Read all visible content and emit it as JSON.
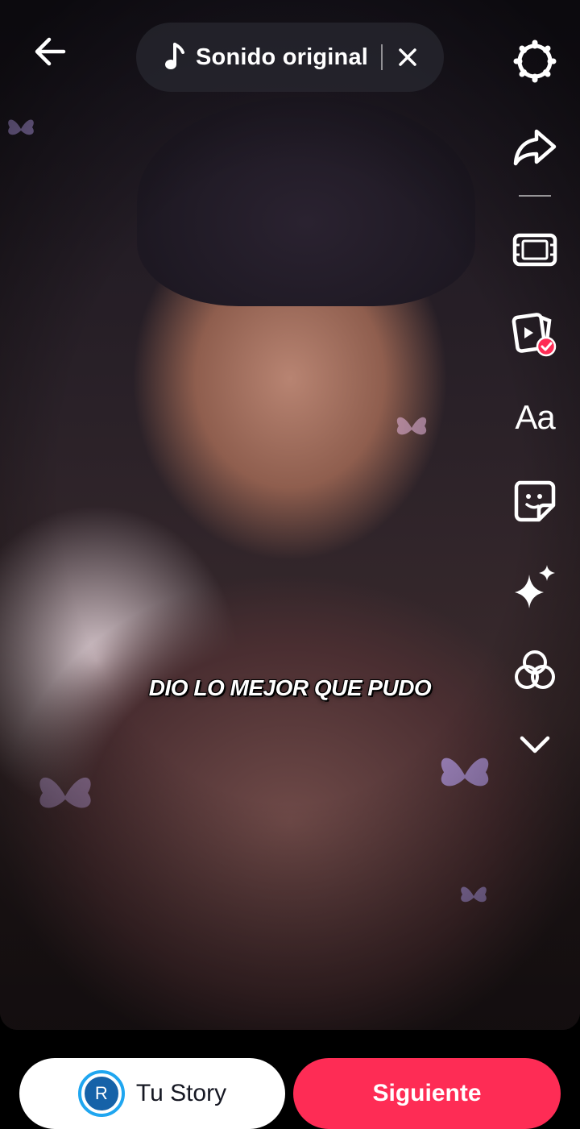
{
  "header": {
    "back_icon": "arrow-left-icon",
    "sound_label": "Sonido original",
    "sound_icon": "music-note-icon",
    "close_icon": "close-icon"
  },
  "tools": {
    "settings_icon": "gear-icon",
    "share_icon": "share-icon",
    "adjust_clips_icon": "film-frame-icon",
    "templates_icon": "video-check-icon",
    "text_label": "Aa",
    "sticker_icon": "sticker-icon",
    "effects_icon": "sparkle-icon",
    "filters_icon": "filters-icon",
    "more_icon": "chevron-down-icon"
  },
  "overlay": {
    "caption": "DIO LO MEJOR QUE PUDO"
  },
  "footer": {
    "avatar_initial": "R",
    "story_label": "Tu Story",
    "next_label": "Siguiente"
  },
  "colors": {
    "accent": "#fe2c55",
    "avatar_ring": "#1fa6f0"
  }
}
